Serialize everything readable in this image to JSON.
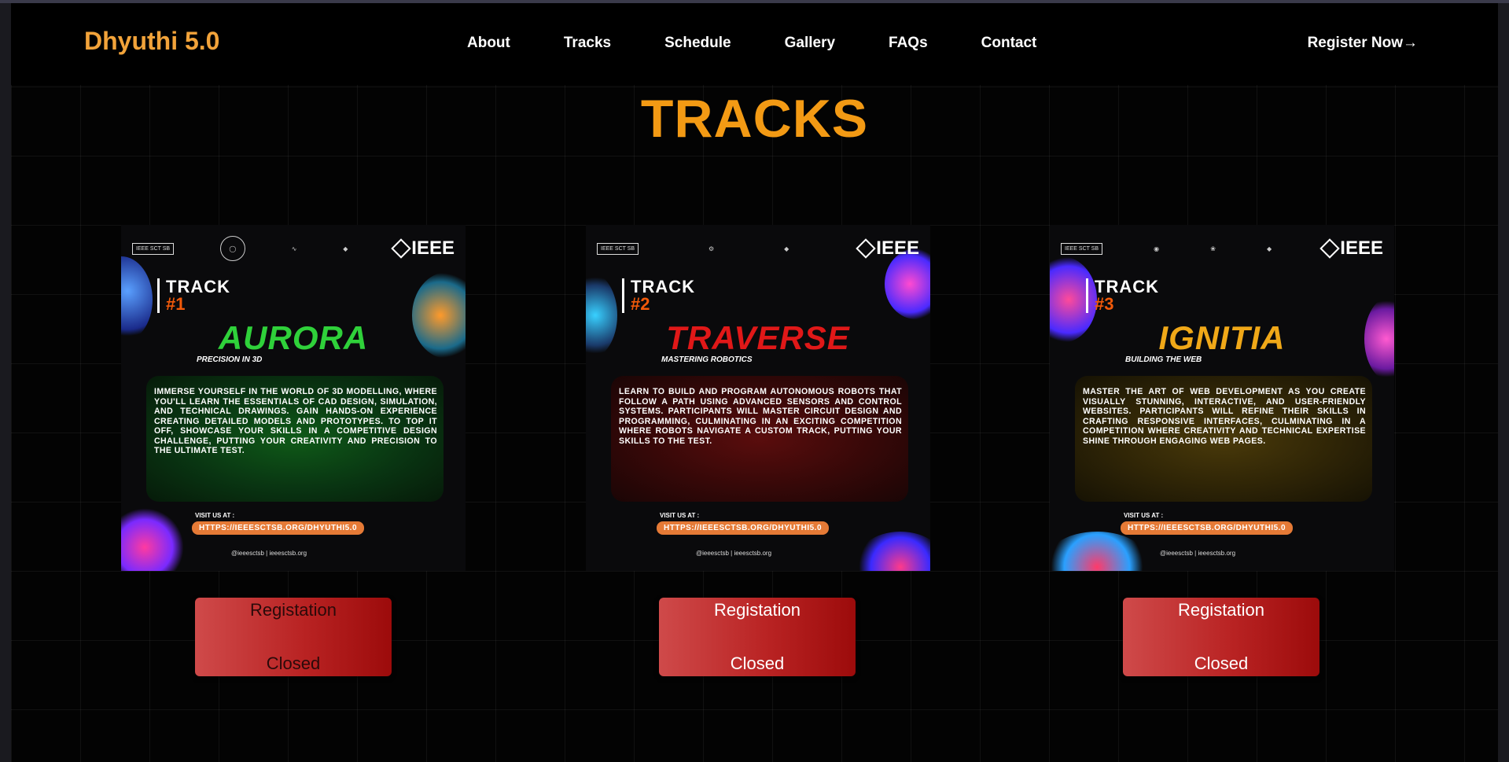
{
  "brand": "Dhyuthi 5.0",
  "nav": [
    "About",
    "Tracks",
    "Schedule",
    "Gallery",
    "FAQs",
    "Contact"
  ],
  "register_now": "Register Now→",
  "section_title": "TRACKS",
  "tracks": [
    {
      "track_word": "TRACK",
      "track_num": "#1",
      "name": "AURORA",
      "subtitle": "PRECISION IN 3D",
      "description": "Immerse yourself in the world of 3D modelling, where you'll learn the essentials of CAD design, simulation, and technical drawings. Gain hands-on experience creating detailed models and prototypes. To top it off, showcase your skills in a competitive design challenge, putting your creativity and precision to the ultimate test.",
      "visit_label": "VISIT US AT :",
      "url": "HTTPS://IEEESCTSB.ORG/DHYUTHI5.0",
      "social": "@ieeesctsb | ieeesctsb.org",
      "name_color": "#2fd13a",
      "glow_color": "#0d4a14",
      "button_line1": "Registation",
      "button_line2": "Closed"
    },
    {
      "track_word": "TRACK",
      "track_num": "#2",
      "name": "TRAVERSE",
      "subtitle": "MASTERING ROBOTICS",
      "description": "Learn to build and program autonomous robots that follow a path using advanced sensors and control systems. Participants will master circuit design and programming, culminating in an exciting competition where robots navigate a custom track, putting your skills to the test.",
      "visit_label": "VISIT US AT :",
      "url": "HTTPS://IEEESCTSB.ORG/DHYUTHI5.0",
      "social": "@ieeesctsb | ieeesctsb.org",
      "name_color": "#e01818",
      "glow_color": "#4a0b0b",
      "button_line1": "Registation",
      "button_line2": "Closed"
    },
    {
      "track_word": "TRACK",
      "track_num": "#3",
      "name": "IGNITIA",
      "subtitle": "BUILDING THE WEB",
      "description": "Master the art of web development as you create visually stunning, interactive, and user-friendly websites. Participants will refine their skills in crafting responsive interfaces, culminating in a competition where creativity and technical expertise shine through engaging web pages.",
      "visit_label": "VISIT US AT :",
      "url": "HTTPS://IEEESCTSB.ORG/DHYUTHI5.0",
      "social": "@ieeesctsb | ieeesctsb.org",
      "name_color": "#f0a818",
      "glow_color": "#3f320a",
      "button_line1": "Registation",
      "button_line2": "Closed"
    }
  ],
  "logos": {
    "ieee": "IEEE",
    "sb": "IEEE SCT SB"
  },
  "colors": {
    "accent": "#f39a14",
    "button": "#b92323"
  }
}
